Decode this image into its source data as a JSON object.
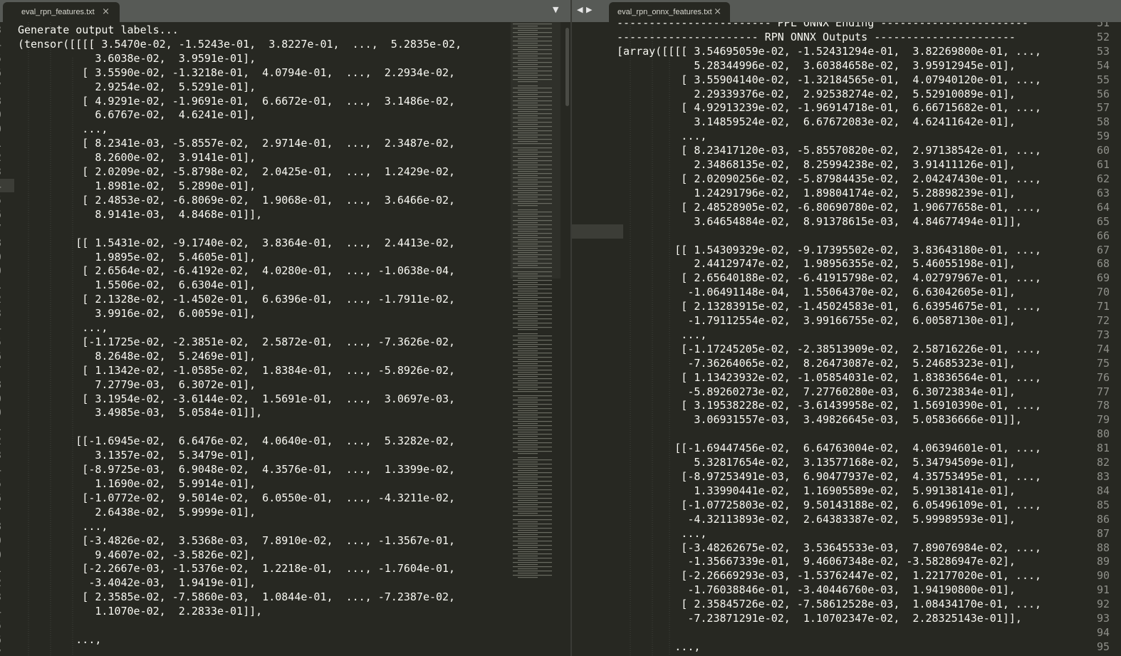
{
  "window": {
    "tabs": [
      {
        "label": "eval_rpn_features.txt",
        "close": "×"
      },
      {
        "label": "eval_rpn_onnx_features.txt",
        "close": "×"
      }
    ],
    "nav": {
      "dropdown": "▼",
      "prev": "◀",
      "next": "▶"
    }
  },
  "left_pane": {
    "line_numbers": [
      "3",
      "4",
      "5",
      "6",
      "7",
      "8",
      "9",
      "0",
      "1",
      "2",
      "3",
      "4",
      "5",
      "6",
      "7",
      "8",
      "9",
      "0",
      "1",
      "2",
      "3",
      "4",
      "5",
      "6",
      "7",
      "8",
      "9",
      "0",
      "1",
      "2",
      "3",
      "4",
      "5",
      "6",
      "7",
      "8",
      "9",
      "0",
      "1",
      "2",
      "3",
      "4",
      "5",
      "6",
      "7"
    ],
    "lines": [
      "Generate output labels...",
      "(tensor([[[[ 3.5470e-02, -1.5243e-01,  3.8227e-01,  ...,  5.2835e-02,",
      "            3.6038e-02,  3.9591e-01],",
      "          [ 3.5590e-02, -1.3218e-01,  4.0794e-01,  ...,  2.2934e-02,",
      "            2.9254e-02,  5.5291e-01],",
      "          [ 4.9291e-02, -1.9691e-01,  6.6672e-01,  ...,  3.1486e-02,",
      "            6.6767e-02,  4.6241e-01],",
      "          ...,",
      "          [ 8.2341e-03, -5.8557e-02,  2.9714e-01,  ...,  2.3487e-02,",
      "            8.2600e-02,  3.9141e-01],",
      "          [ 2.0209e-02, -5.8798e-02,  2.0425e-01,  ...,  1.2429e-02,",
      "            1.8981e-02,  5.2890e-01],",
      "          [ 2.4853e-02, -6.8069e-02,  1.9068e-01,  ...,  3.6466e-02,",
      "            8.9141e-03,  4.8468e-01]],",
      "",
      "         [[ 1.5431e-02, -9.1740e-02,  3.8364e-01,  ...,  2.4413e-02,",
      "            1.9895e-02,  5.4605e-01],",
      "          [ 2.6564e-02, -6.4192e-02,  4.0280e-01,  ..., -1.0638e-04,",
      "            1.5506e-02,  6.6304e-01],",
      "          [ 2.1328e-02, -1.4502e-01,  6.6396e-01,  ..., -1.7911e-02,",
      "            3.9916e-02,  6.0059e-01],",
      "          ...,",
      "          [-1.1725e-02, -2.3851e-02,  2.5872e-01,  ..., -7.3626e-02,",
      "            8.2648e-02,  5.2469e-01],",
      "          [ 1.1342e-02, -1.0585e-02,  1.8384e-01,  ..., -5.8926e-02,",
      "            7.2779e-03,  6.3072e-01],",
      "          [ 3.1954e-02, -3.6144e-02,  1.5691e-01,  ...,  3.0697e-03,",
      "            3.4985e-03,  5.0584e-01]],",
      "",
      "         [[-1.6945e-02,  6.6476e-02,  4.0640e-01,  ...,  5.3282e-02,",
      "            3.1357e-02,  5.3479e-01],",
      "          [-8.9725e-03,  6.9048e-02,  4.3576e-01,  ...,  1.3399e-02,",
      "            1.1690e-02,  5.9914e-01],",
      "          [-1.0772e-02,  9.5014e-02,  6.0550e-01,  ..., -4.3211e-02,",
      "            2.6438e-02,  5.9999e-01],",
      "          ...,",
      "          [-3.4826e-02,  3.5368e-03,  7.8910e-02,  ..., -1.3567e-01,",
      "            9.4607e-02, -3.5826e-02],",
      "          [-2.2667e-03, -1.5376e-02,  1.2218e-01,  ..., -1.7604e-01,",
      "           -3.4042e-03,  1.9419e-01],",
      "          [ 2.3585e-02, -7.5860e-03,  1.0844e-01,  ..., -7.2387e-02,",
      "            1.1070e-02,  2.2833e-01]],",
      "",
      "         ...,",
      ""
    ]
  },
  "right_pane": {
    "line_numbers": [
      "51",
      "52",
      "53",
      "54",
      "55",
      "56",
      "57",
      "58",
      "59",
      "60",
      "61",
      "62",
      "63",
      "64",
      "65",
      "66",
      "67",
      "68",
      "69",
      "70",
      "71",
      "72",
      "73",
      "74",
      "75",
      "76",
      "77",
      "78",
      "79",
      "80",
      "81",
      "82",
      "83",
      "84",
      "85",
      "86",
      "87",
      "88",
      "89",
      "90",
      "91",
      "92",
      "93",
      "94",
      "95"
    ],
    "lines": [
      "------------------------ PPL ONNX Ending -----------------------",
      "---------------------- RPN ONNX Outputs ----------------------",
      "[array([[[[ 3.54695059e-02, -1.52431294e-01,  3.82269800e-01, ...,",
      "            5.28344996e-02,  3.60384658e-02,  3.95912945e-01],",
      "          [ 3.55904140e-02, -1.32184565e-01,  4.07940120e-01, ...,",
      "            2.29339376e-02,  2.92538274e-02,  5.52910089e-01],",
      "          [ 4.92913239e-02, -1.96914718e-01,  6.66715682e-01, ...,",
      "            3.14859524e-02,  6.67672083e-02,  4.62411642e-01],",
      "          ...,",
      "          [ 8.23417120e-03, -5.85570820e-02,  2.97138542e-01, ...,",
      "            2.34868135e-02,  8.25994238e-02,  3.91411126e-01],",
      "          [ 2.02090256e-02, -5.87984435e-02,  2.04247430e-01, ...,",
      "            1.24291796e-02,  1.89804174e-02,  5.28898239e-01],",
      "          [ 2.48528905e-02, -6.80690780e-02,  1.90677658e-01, ...,",
      "            3.64654884e-02,  8.91378615e-03,  4.84677494e-01]],",
      "",
      "         [[ 1.54309329e-02, -9.17395502e-02,  3.83643180e-01, ...,",
      "            2.44129747e-02,  1.98956355e-02,  5.46055198e-01],",
      "          [ 2.65640188e-02, -6.41915798e-02,  4.02797967e-01, ...,",
      "           -1.06491148e-04,  1.55064370e-02,  6.63042605e-01],",
      "          [ 2.13283915e-02, -1.45024583e-01,  6.63954675e-01, ...,",
      "           -1.79112554e-02,  3.99166755e-02,  6.00587130e-01],",
      "          ...,",
      "          [-1.17245205e-02, -2.38513909e-02,  2.58716226e-01, ...,",
      "           -7.36264065e-02,  8.26473087e-02,  5.24685323e-01],",
      "          [ 1.13423932e-02, -1.05854031e-02,  1.83836564e-01, ...,",
      "           -5.89260273e-02,  7.27760280e-03,  6.30723834e-01],",
      "          [ 3.19538228e-02, -3.61439958e-02,  1.56910390e-01, ...,",
      "            3.06931557e-03,  3.49826645e-03,  5.05836666e-01]],",
      "",
      "         [[-1.69447456e-02,  6.64763004e-02,  4.06394601e-01, ...,",
      "            5.32817654e-02,  3.13577168e-02,  5.34794509e-01],",
      "          [-8.97253491e-03,  6.90477937e-02,  4.35753495e-01, ...,",
      "            1.33990441e-02,  1.16905589e-02,  5.99138141e-01],",
      "          [-1.07725803e-02,  9.50143188e-02,  6.05496109e-01, ...,",
      "           -4.32113893e-02,  2.64383387e-02,  5.99989593e-01],",
      "          ...,",
      "          [-3.48262675e-02,  3.53645533e-03,  7.89076984e-02, ...,",
      "           -1.35667339e-01,  9.46067348e-02, -3.58286947e-02],",
      "          [-2.26669293e-03, -1.53762447e-02,  1.22177020e-01, ...,",
      "           -1.76038846e-01, -3.40446760e-03,  1.94190800e-01],",
      "          [ 2.35845726e-02, -7.58612528e-03,  1.08434170e-01, ...,",
      "           -7.23871291e-02,  1.10702347e-02,  2.28325143e-01]],",
      "",
      "         ...,"
    ]
  },
  "colors": {
    "background": "#272822",
    "text": "#f8f8f2",
    "line_number": "#8f908a",
    "tabbar": "#575a56"
  }
}
